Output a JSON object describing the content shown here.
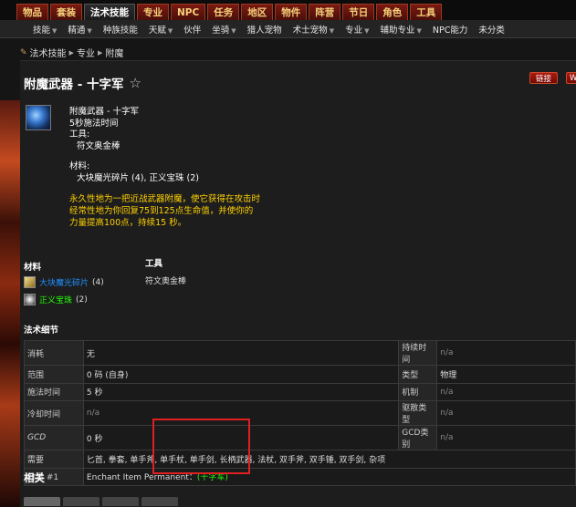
{
  "topnav": {
    "tabs": [
      "物品",
      "套装",
      "法术技能",
      "专业",
      "NPC",
      "任务",
      "地区",
      "物件",
      "阵营",
      "节日",
      "角色",
      "工具"
    ],
    "active_index": 2
  },
  "subnav": {
    "items": [
      {
        "label": "技能",
        "dropdown": true
      },
      {
        "label": "精通",
        "dropdown": true
      },
      {
        "label": "种族技能",
        "dropdown": false
      },
      {
        "label": "天赋",
        "dropdown": true
      },
      {
        "label": "伙伴",
        "dropdown": false
      },
      {
        "label": "坐骑",
        "dropdown": true
      },
      {
        "label": "猎人宠物",
        "dropdown": false
      },
      {
        "label": "术士宠物",
        "dropdown": true
      },
      {
        "label": "专业",
        "dropdown": true
      },
      {
        "label": "辅助专业",
        "dropdown": true
      },
      {
        "label": "NPC能力",
        "dropdown": false
      },
      {
        "label": "未分类",
        "dropdown": false
      }
    ]
  },
  "breadcrumb": [
    "法术技能",
    "专业",
    "附魔"
  ],
  "page": {
    "title": "附魔武器 - 十字军",
    "btn_link": "链接",
    "btn_more": "W"
  },
  "tooltip": {
    "name": "附魔武器 - 十字军",
    "cast": "5秒施法时间",
    "tools_label": "工具:",
    "tool": "符文奥金棒",
    "reagents_label": "材料:",
    "reagents": "大块魔光碎片 (4), 正义宝珠 (2)",
    "desc": "永久性地为一把近战武器附魔，使它获得在攻击时经常性地为你回复75到125点生命值，并使你的力量提高100点，持续15 秒。"
  },
  "materials": {
    "header": "材料",
    "items": [
      {
        "name": "大块魔光碎片",
        "count": "(4)",
        "quality": "blue"
      },
      {
        "name": "正义宝珠",
        "count": "(2)",
        "quality": "green"
      }
    ]
  },
  "tools": {
    "header": "工具",
    "items": [
      "符文奥金棒"
    ]
  },
  "spell_details": {
    "header": "法术细节",
    "rows": [
      {
        "l1": "消耗",
        "v1": "无",
        "l2": "持续时间",
        "v2": "n/a"
      },
      {
        "l1": "范围",
        "v1": "0 码 (自身)",
        "l2": "类型",
        "v2": "物理"
      },
      {
        "l1": "施法时间",
        "v1": "5 秒",
        "l2": "机制",
        "v2": "n/a"
      },
      {
        "l1": "冷却时间",
        "v1": "n/a",
        "l2": "驱散类型",
        "v2": "n/a"
      },
      {
        "l1": "GCD",
        "v1": "0 秒",
        "l2": "GCD类别",
        "v2": "n/a"
      }
    ],
    "requires_label": "需要",
    "requires_value": "匕首, 拳套, 单手斧, 单手杖, 单手剑, 长柄武器, 法杖, 双手斧, 双手锤, 双手剑, 杂项",
    "effect_label": "效果 #1",
    "effect_text": "Enchant Item Permanent：",
    "effect_link": "(十字军)"
  },
  "related": {
    "header": "相关"
  }
}
